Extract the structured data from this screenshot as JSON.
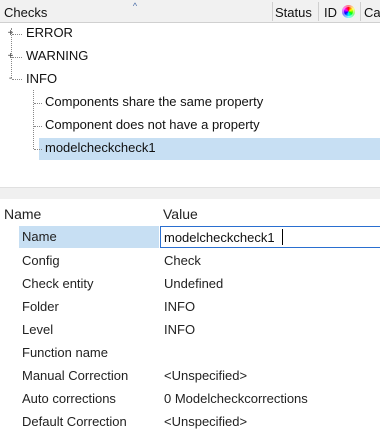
{
  "tree_header": {
    "col_checks": "Checks",
    "col_status": "Status",
    "col_id": "ID",
    "col_ca": "Ca",
    "color_icon": "color-wheel-icon"
  },
  "tree": {
    "error": "ERROR",
    "warning": "WARNING",
    "info": "INFO",
    "children": [
      "Components share the same property",
      "Component does not have a property",
      "modelcheckcheck1"
    ]
  },
  "props_header": {
    "name": "Name",
    "value": "Value"
  },
  "props": {
    "name_label": "Name",
    "name_value": "modelcheckcheck1",
    "rows": [
      {
        "label": "Config",
        "value": "Check"
      },
      {
        "label": "Check entity",
        "value": "Undefined"
      },
      {
        "label": "Folder",
        "value": "INFO"
      },
      {
        "label": "Level",
        "value": "INFO"
      },
      {
        "label": "Function name",
        "value": ""
      },
      {
        "label": "Manual Correction",
        "value": "<Unspecified>"
      },
      {
        "label": "Auto corrections",
        "value": "0 Modelcheckcorrections"
      },
      {
        "label": "Default Correction",
        "value": "<Unspecified>"
      }
    ]
  },
  "colors": {
    "selection": "#c7dff3",
    "input_border": "#2a6fd0",
    "header_bg": "#f1f1f1"
  }
}
